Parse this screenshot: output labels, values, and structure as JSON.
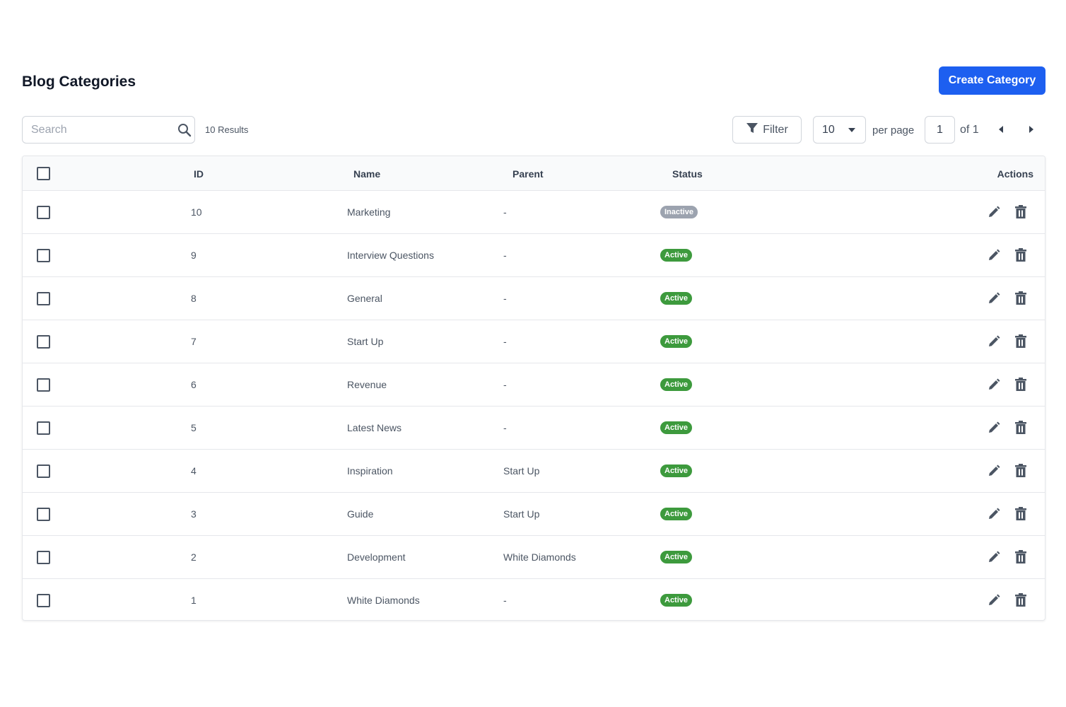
{
  "header": {
    "title": "Blog Categories",
    "create_label": "Create Category"
  },
  "toolbar": {
    "search_placeholder": "Search",
    "results_text": "10 Results",
    "filter_label": "Filter",
    "per_page_value": "10",
    "per_page_label": "per page",
    "page_value": "1",
    "page_of_text": "of 1"
  },
  "table": {
    "columns": {
      "id": "ID",
      "name": "Name",
      "parent": "Parent",
      "status": "Status",
      "actions": "Actions"
    },
    "rows": [
      {
        "id": "10",
        "name": "Marketing",
        "parent": "-",
        "status": "Inactive"
      },
      {
        "id": "9",
        "name": "Interview Questions",
        "parent": "-",
        "status": "Active"
      },
      {
        "id": "8",
        "name": "General",
        "parent": "-",
        "status": "Active"
      },
      {
        "id": "7",
        "name": "Start Up",
        "parent": "-",
        "status": "Active"
      },
      {
        "id": "6",
        "name": "Revenue",
        "parent": "-",
        "status": "Active"
      },
      {
        "id": "5",
        "name": "Latest News",
        "parent": "-",
        "status": "Active"
      },
      {
        "id": "4",
        "name": "Inspiration",
        "parent": "Start Up",
        "status": "Active"
      },
      {
        "id": "3",
        "name": "Guide",
        "parent": "Start Up",
        "status": "Active"
      },
      {
        "id": "2",
        "name": "Development",
        "parent": "White Diamonds",
        "status": "Active"
      },
      {
        "id": "1",
        "name": "White Diamonds",
        "parent": "-",
        "status": "Active"
      }
    ]
  },
  "colors": {
    "primary": "#1d5ff0",
    "active_badge": "#3d9a3d",
    "inactive_badge": "#9ca3af",
    "icon": "#4b5563"
  },
  "icons": {
    "search": "search-icon",
    "filter": "filter-icon",
    "dropdown": "caret-down-icon",
    "prev": "caret-left-icon",
    "next": "caret-right-icon",
    "edit": "pencil-icon",
    "delete": "trash-icon"
  }
}
